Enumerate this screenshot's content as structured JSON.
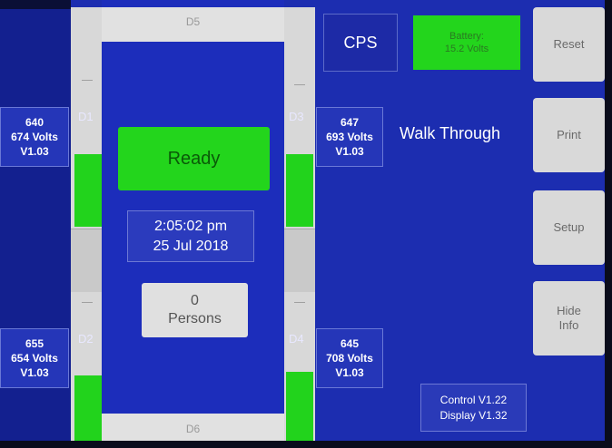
{
  "lanes": {
    "top_label": "D5",
    "bottom_label": "D6",
    "d1": "D1",
    "d2": "D2",
    "d3": "D3",
    "d4": "D4"
  },
  "sensors": {
    "d1": {
      "id": "640",
      "volts": "674 Volts",
      "version": "V1.03"
    },
    "d2": {
      "id": "655",
      "volts": "654 Volts",
      "version": "V1.03"
    },
    "d3": {
      "id": "647",
      "volts": "693 Volts",
      "version": "V1.03"
    },
    "d4": {
      "id": "645",
      "volts": "708 Volts",
      "version": "V1.03"
    }
  },
  "status": {
    "label": "Ready"
  },
  "clock": {
    "time": "2:05:02 pm",
    "date": "25 Jul 2018"
  },
  "persons": {
    "count": "0",
    "label": "Persons"
  },
  "header": {
    "cps": "CPS",
    "battery_label": "Battery:",
    "battery_value": "15.2 Volts",
    "mode": "Walk Through"
  },
  "buttons": {
    "reset": "Reset",
    "print": "Print",
    "setup": "Setup",
    "hide_line1": "Hide",
    "hide_line2": "Info"
  },
  "versions": {
    "control": "Control V1.22",
    "display": "Display V1.32"
  },
  "colors": {
    "screen_blue": "#1c2db0",
    "status_green": "#23d51c",
    "button_gray": "#d9d9d9"
  }
}
